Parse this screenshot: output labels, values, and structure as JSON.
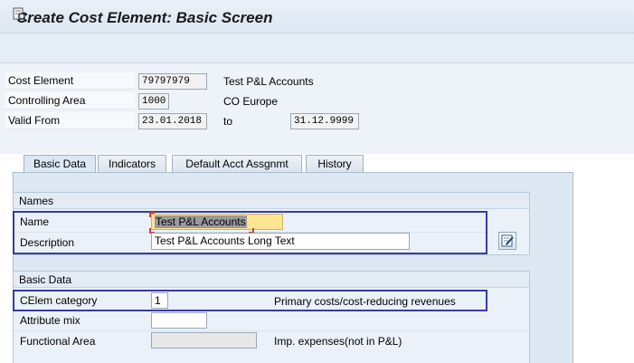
{
  "window": {
    "title": "Create Cost Element: Basic Screen"
  },
  "toolbar": {
    "icons": [
      "change-document-icon"
    ]
  },
  "header": {
    "cost_element_label": "Cost Element",
    "cost_element_value": "79797979",
    "cost_element_text": "Test P&L Accounts",
    "controlling_area_label": "Controlling Area",
    "controlling_area_value": "1000",
    "controlling_area_text": "CO Europe",
    "valid_from_label": "Valid From",
    "valid_from_value": "23.01.2018",
    "to_label": "to",
    "valid_to_value": "31.12.9999"
  },
  "tabs": [
    {
      "label": "Basic Data",
      "active": true
    },
    {
      "label": "Indicators",
      "active": false
    },
    {
      "label": "Default Acct Assgnmt",
      "active": false
    },
    {
      "label": "History",
      "active": false
    }
  ],
  "names_group": {
    "title": "Names",
    "name_label": "Name",
    "name_value": "Test P&L Accounts",
    "description_label": "Description",
    "description_value": "Test P&L Accounts Long Text"
  },
  "basic_data_group": {
    "title": "Basic Data",
    "celem_category_label": "CElem category",
    "celem_category_value": "1",
    "celem_category_text": "Primary costs/cost-reducing revenues",
    "attribute_mix_label": "Attribute mix",
    "attribute_mix_value": "",
    "functional_area_label": "Functional Area",
    "functional_area_value": "",
    "functional_area_text": "Imp. expenses(not in P&L)"
  },
  "colors": {
    "highlight_border": "#3a3aa8",
    "name_field_bg": "#fde591",
    "panel_bg": "#dde8f3"
  }
}
